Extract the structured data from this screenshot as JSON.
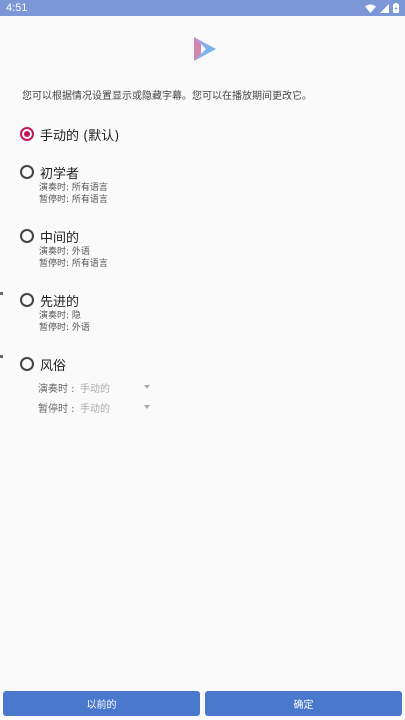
{
  "status_bar": {
    "time": "4:51"
  },
  "intro_text": "您可以根据情况设置显示或隐藏字幕。您可以在播放期间更改它。",
  "options": [
    {
      "label": "手动的 (默认)",
      "checked": true,
      "details": []
    },
    {
      "label": "初学者",
      "checked": false,
      "details": [
        "演奏时: 所有语言",
        "暂停时: 所有语言"
      ]
    },
    {
      "label": "中间的",
      "checked": false,
      "details": [
        "演奏时: 外语",
        "暂停时: 所有语言"
      ]
    },
    {
      "label": "先进的",
      "checked": false,
      "details": [
        "演奏时: 隐",
        "暂停时: 外语"
      ]
    },
    {
      "label": "风俗",
      "checked": false,
      "details": []
    }
  ],
  "custom": {
    "playing_label": "演奏时 :",
    "playing_value": "手动的",
    "paused_label": "暂停时 :",
    "paused_value": "手动的"
  },
  "footer": {
    "back_label": "以前的",
    "confirm_label": "确定"
  },
  "colors": {
    "accent": "#c2185b",
    "primary": "#4a78cc",
    "status_bar": "#7b97d6"
  }
}
